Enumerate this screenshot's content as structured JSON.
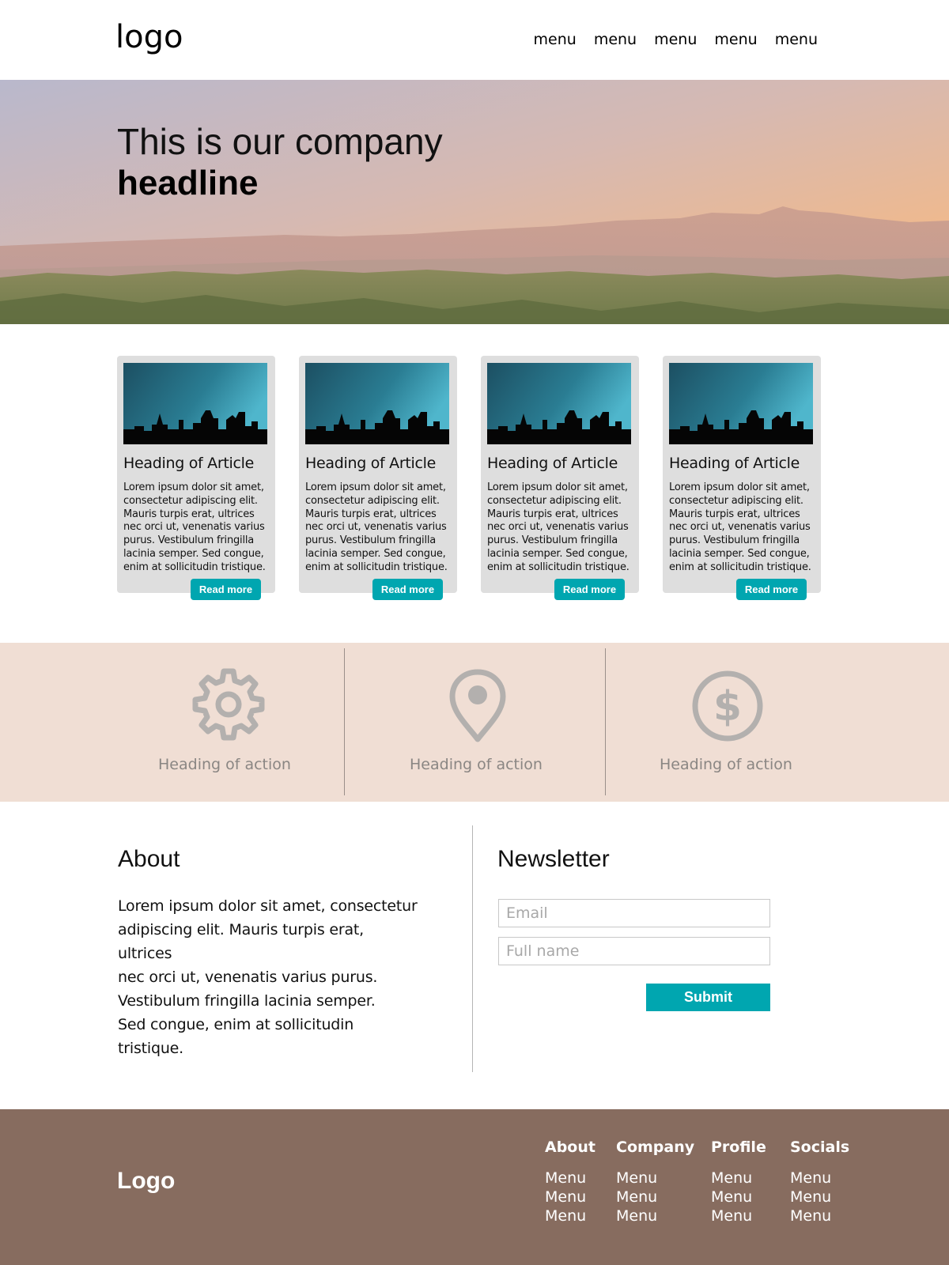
{
  "header": {
    "logo": "logo",
    "menu": [
      "menu",
      "menu",
      "menu",
      "menu",
      "menu"
    ]
  },
  "hero": {
    "line1": "This is our company",
    "line2": "headline"
  },
  "articles": [
    {
      "title": "Heading of Article",
      "body": "Lorem ipsum dolor sit amet, consectetur adipiscing elit. Mauris turpis erat, ultrices nec orci ut, venenatis varius purus. Vestibulum fringilla lacinia semper. Sed congue, enim at sollicitudin tristique.",
      "button": "Read more"
    },
    {
      "title": "Heading of Article",
      "body": "Lorem ipsum dolor sit amet, consectetur adipiscing elit. Mauris turpis erat, ultrices nec orci ut, venenatis varius purus. Vestibulum fringilla lacinia semper. Sed congue, enim at sollicitudin tristique.",
      "button": "Read more"
    },
    {
      "title": "Heading of Article",
      "body": "Lorem ipsum dolor sit amet, consectetur adipiscing elit. Mauris turpis erat, ultrices nec orci ut, venenatis varius purus. Vestibulum fringilla lacinia semper. Sed congue, enim at sollicitudin tristique.",
      "button": "Read more"
    },
    {
      "title": "Heading of Article",
      "body": "Lorem ipsum dolor sit amet, consectetur adipiscing elit. Mauris turpis erat, ultrices nec orci ut, venenatis varius purus. Vestibulum fringilla lacinia semper. Sed congue, enim at sollicitudin tristique.",
      "button": "Read more"
    }
  ],
  "actions": [
    {
      "icon": "gear-icon",
      "label": "Heading of action"
    },
    {
      "icon": "location-pin-icon",
      "label": "Heading of action"
    },
    {
      "icon": "dollar-circle-icon",
      "label": "Heading of action"
    }
  ],
  "about": {
    "title": "About",
    "lines": [
      "Lorem ipsum dolor sit amet, consectetur",
      "adipiscing elit. Mauris turpis erat, ultrices",
      "nec orci ut, venenatis varius purus.",
      "Vestibulum fringilla lacinia semper.",
      "Sed congue, enim at sollicitudin tristique."
    ]
  },
  "newsletter": {
    "title": "Newsletter",
    "email_placeholder": "Email",
    "name_placeholder": "Full name",
    "submit": "Submit"
  },
  "footer": {
    "logo": "Logo",
    "columns": [
      {
        "title": "About",
        "items": [
          "Menu",
          "Menu",
          "Menu"
        ]
      },
      {
        "title": "Company",
        "items": [
          "Menu",
          "Menu",
          "Menu"
        ]
      },
      {
        "title": "Profile",
        "items": [
          "Menu",
          "Menu",
          "Menu"
        ]
      },
      {
        "title": "Socials",
        "items": [
          "Menu",
          "Menu",
          "Menu"
        ]
      }
    ]
  },
  "colors": {
    "accent": "#00a6b0",
    "action_band": "#f0ded4",
    "footer": "#876c5f",
    "card": "#dedede",
    "icon_gray": "#b3b0ae"
  }
}
